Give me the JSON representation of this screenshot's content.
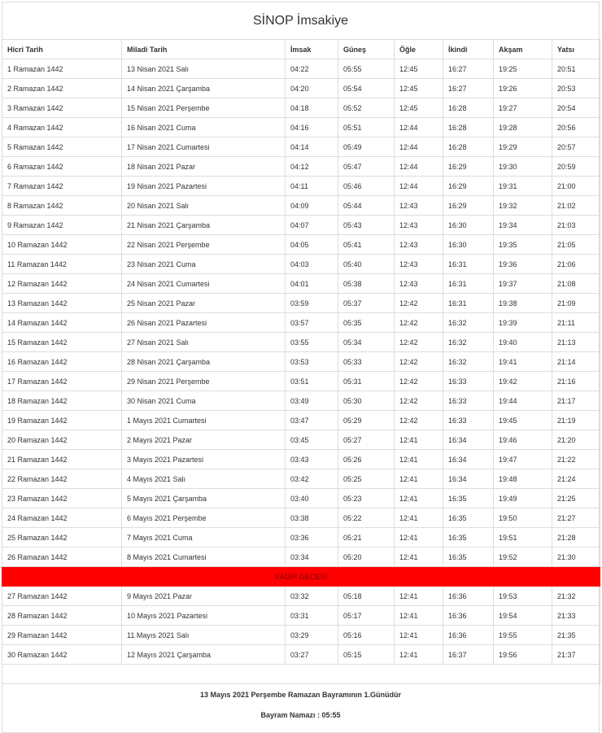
{
  "title": "SİNOP İmsakiye",
  "columns": [
    "Hicri Tarih",
    "Miladi Tarih",
    "İmsak",
    "Güneş",
    "Öğle",
    "İkindi",
    "Akşam",
    "Yatsı"
  ],
  "rows_before": [
    [
      "1 Ramazan 1442",
      "13 Nisan 2021 Salı",
      "04:22",
      "05:55",
      "12:45",
      "16:27",
      "19:25",
      "20:51"
    ],
    [
      "2 Ramazan 1442",
      "14 Nisan 2021 Çarşamba",
      "04:20",
      "05:54",
      "12:45",
      "16:27",
      "19:26",
      "20:53"
    ],
    [
      "3 Ramazan 1442",
      "15 Nisan 2021 Perşembe",
      "04:18",
      "05:52",
      "12:45",
      "16:28",
      "19:27",
      "20:54"
    ],
    [
      "4 Ramazan 1442",
      "16 Nisan 2021 Cuma",
      "04:16",
      "05:51",
      "12:44",
      "16:28",
      "19:28",
      "20:56"
    ],
    [
      "5 Ramazan 1442",
      "17 Nisan 2021 Cumartesi",
      "04:14",
      "05:49",
      "12:44",
      "16:28",
      "19:29",
      "20:57"
    ],
    [
      "6 Ramazan 1442",
      "18 Nisan 2021 Pazar",
      "04:12",
      "05:47",
      "12:44",
      "16:29",
      "19:30",
      "20:59"
    ],
    [
      "7 Ramazan 1442",
      "19 Nisan 2021 Pazartesi",
      "04:11",
      "05:46",
      "12:44",
      "16:29",
      "19:31",
      "21:00"
    ],
    [
      "8 Ramazan 1442",
      "20 Nisan 2021 Salı",
      "04:09",
      "05:44",
      "12:43",
      "16:29",
      "19:32",
      "21:02"
    ],
    [
      "9 Ramazan 1442",
      "21 Nisan 2021 Çarşamba",
      "04:07",
      "05:43",
      "12:43",
      "16:30",
      "19:34",
      "21:03"
    ],
    [
      "10 Ramazan 1442",
      "22 Nisan 2021 Perşembe",
      "04:05",
      "05:41",
      "12:43",
      "16:30",
      "19:35",
      "21:05"
    ],
    [
      "11 Ramazan 1442",
      "23 Nisan 2021 Cuma",
      "04:03",
      "05:40",
      "12:43",
      "16:31",
      "19:36",
      "21:06"
    ],
    [
      "12 Ramazan 1442",
      "24 Nisan 2021 Cumartesi",
      "04:01",
      "05:38",
      "12:43",
      "16:31",
      "19:37",
      "21:08"
    ],
    [
      "13 Ramazan 1442",
      "25 Nisan 2021 Pazar",
      "03:59",
      "05:37",
      "12:42",
      "16:31",
      "19:38",
      "21:09"
    ],
    [
      "14 Ramazan 1442",
      "26 Nisan 2021 Pazartesi",
      "03:57",
      "05:35",
      "12:42",
      "16:32",
      "19:39",
      "21:11"
    ],
    [
      "15 Ramazan 1442",
      "27 Nisan 2021 Salı",
      "03:55",
      "05:34",
      "12:42",
      "16:32",
      "19:40",
      "21:13"
    ],
    [
      "16 Ramazan 1442",
      "28 Nisan 2021 Çarşamba",
      "03:53",
      "05:33",
      "12:42",
      "16:32",
      "19:41",
      "21:14"
    ],
    [
      "17 Ramazan 1442",
      "29 Nisan 2021 Perşembe",
      "03:51",
      "05:31",
      "12:42",
      "16:33",
      "19:42",
      "21:16"
    ],
    [
      "18 Ramazan 1442",
      "30 Nisan 2021 Cuma",
      "03:49",
      "05:30",
      "12:42",
      "16:33",
      "19:44",
      "21:17"
    ],
    [
      "19 Ramazan 1442",
      "1 Mayıs 2021 Cumartesi",
      "03:47",
      "05:29",
      "12:42",
      "16:33",
      "19:45",
      "21:19"
    ],
    [
      "20 Ramazan 1442",
      "2 Mayıs 2021 Pazar",
      "03:45",
      "05:27",
      "12:41",
      "16:34",
      "19:46",
      "21:20"
    ],
    [
      "21 Ramazan 1442",
      "3 Mayıs 2021 Pazartesi",
      "03:43",
      "05:26",
      "12:41",
      "16:34",
      "19:47",
      "21:22"
    ],
    [
      "22 Ramazan 1442",
      "4 Mayıs 2021 Salı",
      "03:42",
      "05:25",
      "12:41",
      "16:34",
      "19:48",
      "21:24"
    ],
    [
      "23 Ramazan 1442",
      "5 Mayıs 2021 Çarşamba",
      "03:40",
      "05:23",
      "12:41",
      "16:35",
      "19:49",
      "21:25"
    ],
    [
      "24 Ramazan 1442",
      "6 Mayıs 2021 Perşembe",
      "03:38",
      "05:22",
      "12:41",
      "16:35",
      "19:50",
      "21:27"
    ],
    [
      "25 Ramazan 1442",
      "7 Mayıs 2021 Cuma",
      "03:36",
      "05:21",
      "12:41",
      "16:35",
      "19:51",
      "21:28"
    ],
    [
      "26 Ramazan 1442",
      "8 Mayıs 2021 Cumartesi",
      "03:34",
      "05:20",
      "12:41",
      "16:35",
      "19:52",
      "21:30"
    ]
  ],
  "special_row": {
    "label": "KADİR GECESİ",
    "color": "#ff0000"
  },
  "rows_after": [
    [
      "27 Ramazan 1442",
      "9 Mayıs 2021 Pazar",
      "03:32",
      "05:18",
      "12:41",
      "16:36",
      "19:53",
      "21:32"
    ],
    [
      "28 Ramazan 1442",
      "10 Mayıs 2021 Pazartesi",
      "03:31",
      "05:17",
      "12:41",
      "16:36",
      "19:54",
      "21:33"
    ],
    [
      "29 Ramazan 1442",
      "11 Mayıs 2021 Salı",
      "03:29",
      "05:16",
      "12:41",
      "16:36",
      "19:55",
      "21:35"
    ],
    [
      "30 Ramazan 1442",
      "12 Mayıs 2021 Çarşamba",
      "03:27",
      "05:15",
      "12:41",
      "16:37",
      "19:56",
      "21:37"
    ]
  ],
  "footer": {
    "line1": "13 Mayıs 2021 Perşembe Ramazan Bayramının 1.Günüdür",
    "line2": "Bayram Namazı : 05:55"
  }
}
